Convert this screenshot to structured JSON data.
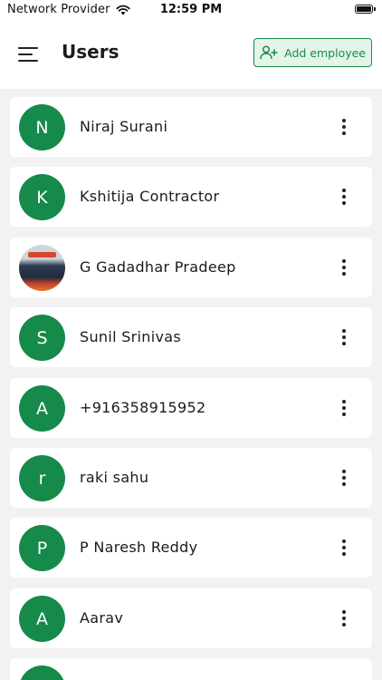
{
  "status_bar": {
    "carrier": "Network Provider",
    "time": "12:59 PM"
  },
  "header": {
    "title": "Users",
    "add_button_label": "Add employee"
  },
  "colors": {
    "accent": "#158a4a",
    "accent_light": "#e4f4e9",
    "background": "#f2f2f2"
  },
  "users": [
    {
      "initial": "N",
      "name": "Niraj Surani"
    },
    {
      "initial": "K",
      "name": "Kshitija Contractor"
    },
    {
      "initial": "",
      "name": "G Gadadhar Pradeep",
      "avatar": "photo"
    },
    {
      "initial": "S",
      "name": "Sunil Srinivas"
    },
    {
      "initial": "A",
      "name": "+916358915952"
    },
    {
      "initial": "r",
      "name": "raki sahu"
    },
    {
      "initial": "P",
      "name": "P Naresh Reddy"
    },
    {
      "initial": "A",
      "name": "Aarav"
    },
    {
      "initial": "",
      "name": ""
    }
  ]
}
